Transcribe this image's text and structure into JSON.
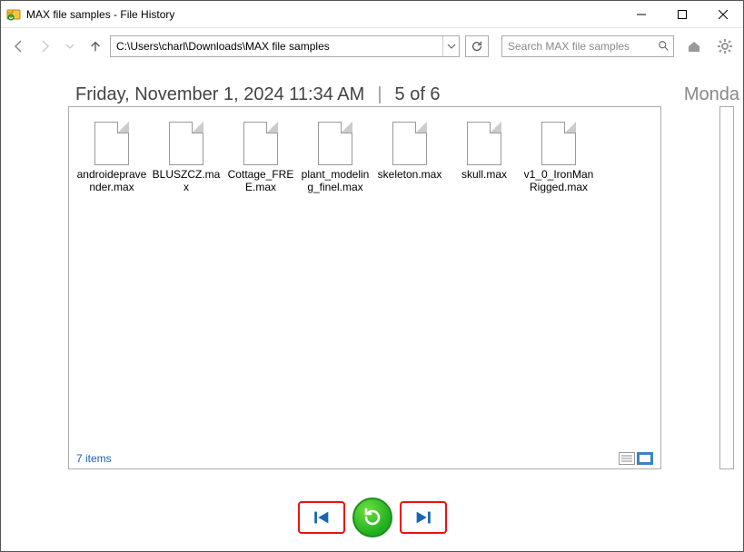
{
  "window": {
    "title": "MAX file samples - File History"
  },
  "toolbar": {
    "path": "C:\\Users\\charl\\Downloads\\MAX file samples",
    "search_placeholder": "Search MAX file samples"
  },
  "header": {
    "timestamp": "Friday, November 1, 2024 11:34 AM",
    "position": "5 of 6",
    "next_label_peek": "Monda"
  },
  "files": [
    {
      "name": "androidepravender.max"
    },
    {
      "name": "BLUSZCZ.max"
    },
    {
      "name": "Cottage_FREE.max"
    },
    {
      "name": "plant_modeling_finel.max"
    },
    {
      "name": "skeleton.max"
    },
    {
      "name": "skull.max"
    },
    {
      "name": "v1_0_IronManRigged.max"
    }
  ],
  "status": {
    "count_label": "7 items"
  }
}
